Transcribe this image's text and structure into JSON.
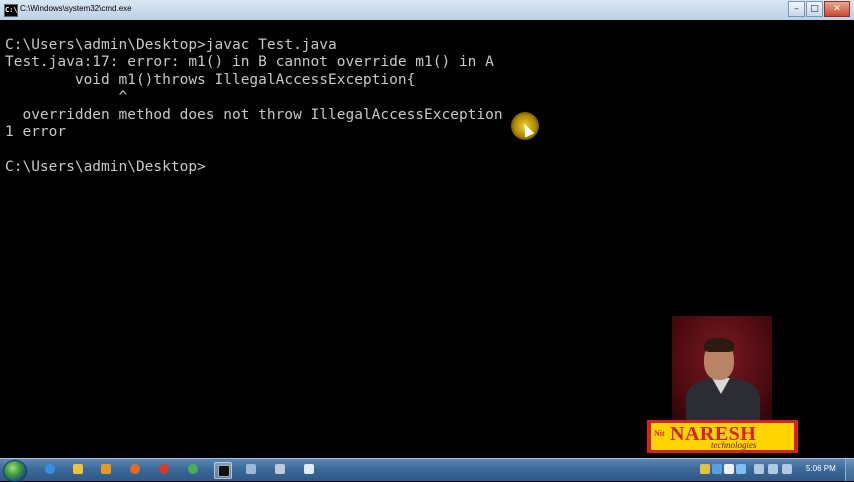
{
  "window": {
    "title": "C:\\Windows\\system32\\cmd.exe",
    "icon": "cmd-icon",
    "icon_glyph": "C:\\",
    "buttons": {
      "minimize": "–",
      "maximize": "□",
      "close": "✕"
    }
  },
  "console": {
    "lines": [
      "",
      "C:\\Users\\admin\\Desktop>javac Test.java",
      "Test.java:17: error: m1() in B cannot override m1() in A",
      "        void m1()throws IllegalAccessException{",
      "             ^",
      "  overridden method does not throw IllegalAccessException",
      "1 error",
      "",
      "C:\\Users\\admin\\Desktop>"
    ],
    "text_color": "#c8c8c8",
    "background": "#000000"
  },
  "overlay": {
    "logo_prefix": "Nit",
    "logo_name": "NARESH",
    "logo_sub": "technologies",
    "logo_colors": {
      "red": "#d71f26",
      "yellow": "#ffd400"
    }
  },
  "taskbar": {
    "start": "start-orb-icon",
    "apps": [
      "ie-icon",
      "explorer-icon",
      "media-player-icon",
      "firefox-icon",
      "chrome-icon",
      "chrome-icon",
      "cmd-icon",
      "app-icon",
      "app-icon",
      "notepad-icon"
    ],
    "tray_icons": [
      "network-icon",
      "volume-icon",
      "flag-icon",
      "signal-icon",
      "app-tray-icon",
      "app-tray-icon",
      "app-tray-icon"
    ],
    "clock": "5:06 PM"
  }
}
